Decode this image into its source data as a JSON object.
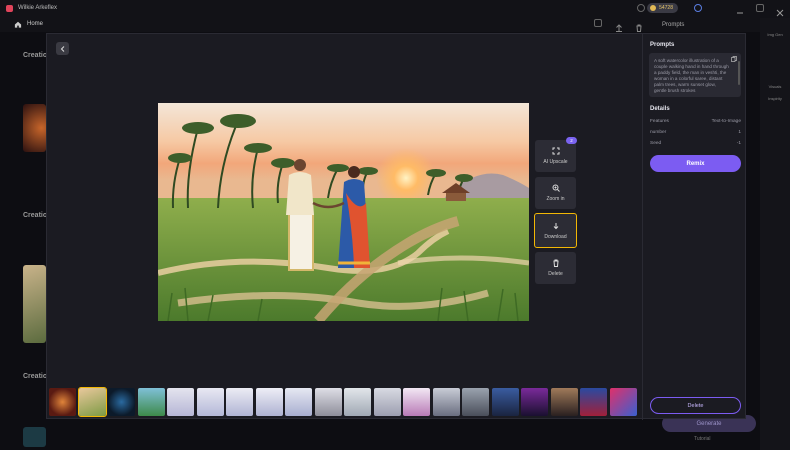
{
  "app": {
    "title": "Wilkie Arkeflex",
    "home_label": "Home",
    "credits": "54728"
  },
  "background": {
    "prompts_heading": "Prompts",
    "sections": [
      "Creatio",
      "Creatio",
      "Creatio"
    ],
    "sidebar_items": [
      "Img Gen",
      "Visuals",
      "Inspirity"
    ],
    "generate_label": "Generate",
    "tutorial_label": "Tutorial"
  },
  "viewer": {
    "actions": [
      {
        "label": "AI Upscale",
        "icon": "upscale-icon",
        "badge": "2"
      },
      {
        "label": "Zoom in",
        "icon": "zoom-in-icon"
      },
      {
        "label": "Download",
        "icon": "download-icon"
      },
      {
        "label": "Delete",
        "icon": "trash-icon"
      }
    ],
    "image_description_icon": "watercolor-couple-paddy-field"
  },
  "panel": {
    "prompts_title": "Prompts",
    "prompt_text": "A soft watercolor illustration of a couple walking hand in hand through a paddy field, the man in veshti, the woman in a colorful saree, distant palm trees, warm sunset glow, gentle brush strokes",
    "details_title": "Details",
    "details": [
      {
        "key": "Features",
        "value": "Text-to-Image"
      },
      {
        "key": "number",
        "value": "1"
      },
      {
        "key": "Seed",
        "value": "-1"
      }
    ],
    "remix_label": "Remix",
    "delete_label": "Delete"
  },
  "colors": {
    "accent": "#7c5cf2",
    "selected_outline": "#f2b705",
    "modal_bg": "#1b1b22"
  }
}
